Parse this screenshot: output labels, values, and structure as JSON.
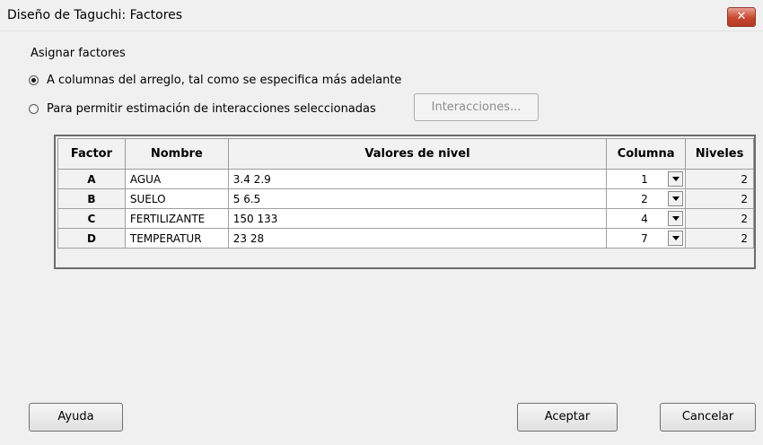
{
  "window": {
    "title": "Diseño de Taguchi: Factores",
    "close_symbol": "✕"
  },
  "assign": {
    "group_label": "Asignar factores",
    "option_columns": "A columnas del arreglo, tal como se especifica más adelante",
    "option_interactions": "Para permitir estimación de interacciones seleccionadas",
    "selected": "option_columns",
    "interactions_button": "Interacciones..."
  },
  "table": {
    "headers": {
      "factor": "Factor",
      "name": "Nombre",
      "levels_values": "Valores de nivel",
      "column": "Columna",
      "levels": "Niveles"
    },
    "rows": [
      {
        "factor": "A",
        "name": "AGUA",
        "values": "3.4 2.9",
        "column": "1",
        "levels": "2"
      },
      {
        "factor": "B",
        "name": "SUELO",
        "values": "5 6.5",
        "column": "2",
        "levels": "2"
      },
      {
        "factor": "C",
        "name": "FERTILIZANTE",
        "values": "150 133",
        "column": "4",
        "levels": "2"
      },
      {
        "factor": "D",
        "name": "TEMPERATUR",
        "values": "23 28",
        "column": "7",
        "levels": "2"
      }
    ]
  },
  "buttons": {
    "help": "Ayuda",
    "ok": "Aceptar",
    "cancel": "Cancelar"
  }
}
